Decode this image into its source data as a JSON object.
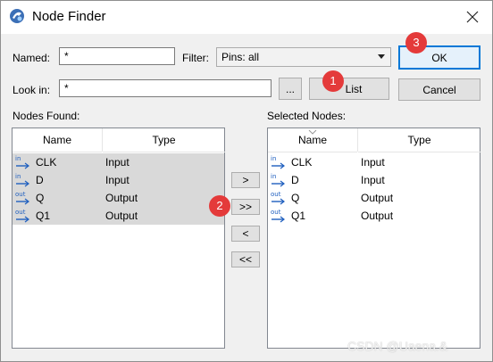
{
  "window": {
    "title": "Node Finder"
  },
  "form": {
    "named_label": "Named:",
    "named_value": "*",
    "filter_label": "Filter:",
    "filter_value": "Pins: all",
    "lookin_label": "Look in:",
    "lookin_value": "*",
    "browse_label": "...",
    "list_label": "List",
    "ok_label": "OK",
    "cancel_label": "Cancel"
  },
  "nodes_found": {
    "label": "Nodes Found:",
    "columns": [
      "Name",
      "Type"
    ],
    "rows": [
      {
        "icon": "in",
        "name": "CLK",
        "type": "Input"
      },
      {
        "icon": "in",
        "name": "D",
        "type": "Input"
      },
      {
        "icon": "out",
        "name": "Q",
        "type": "Output"
      },
      {
        "icon": "out",
        "name": "Q1",
        "type": "Output"
      }
    ]
  },
  "selected_nodes": {
    "label": "Selected Nodes:",
    "columns": [
      "Name",
      "Type"
    ],
    "rows": [
      {
        "icon": "in",
        "name": "CLK",
        "type": "Input"
      },
      {
        "icon": "in",
        "name": "D",
        "type": "Input"
      },
      {
        "icon": "out",
        "name": "Q",
        "type": "Output"
      },
      {
        "icon": "out",
        "name": "Q1",
        "type": "Output"
      }
    ]
  },
  "transfer": {
    "add_one": ">",
    "add_all": ">>",
    "remove_one": "<",
    "remove_all": "<<"
  },
  "badges": [
    "1",
    "2",
    "3"
  ],
  "watermark": "CSDN @Uaena.&",
  "colors": {
    "badge": "#e43a3a",
    "selection": "#d9d9d9",
    "pin_icon": "#1f5fbf",
    "focus_border": "#0078d7"
  }
}
